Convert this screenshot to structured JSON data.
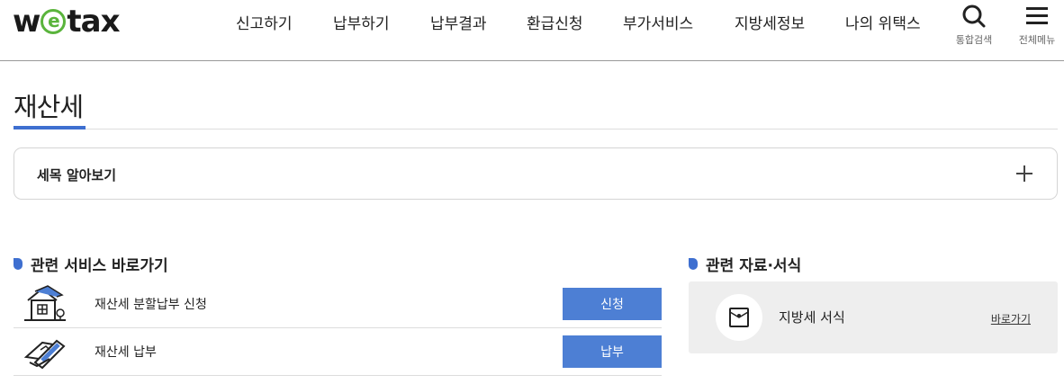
{
  "header": {
    "logo_text": "wetax",
    "logo_accent_color": "#5ab43c",
    "nav": [
      {
        "label": "신고하기"
      },
      {
        "label": "납부하기"
      },
      {
        "label": "납부결과"
      },
      {
        "label": "환급신청"
      },
      {
        "label": "부가서비스"
      },
      {
        "label": "지방세정보"
      },
      {
        "label": "나의 위택스"
      }
    ],
    "search_label": "통합검색",
    "menu_label": "전체메뉴"
  },
  "page": {
    "title": "재산세",
    "accent_color": "#3e6fd0"
  },
  "accordion": {
    "label": "세목 알아보기"
  },
  "services": {
    "title": "관련 서비스 바로가기",
    "items": [
      {
        "name": "재산세 분할납부 신청",
        "button": "신청",
        "icon": "house-icon"
      },
      {
        "name": "재산세 납부",
        "button": "납부",
        "icon": "card-payment-icon"
      }
    ],
    "button_color": "#4d7fd4"
  },
  "documents": {
    "title": "관련 자료·서식",
    "items": [
      {
        "name": "지방세 서식",
        "link": "바로가기",
        "icon": "envelope-icon"
      }
    ]
  }
}
